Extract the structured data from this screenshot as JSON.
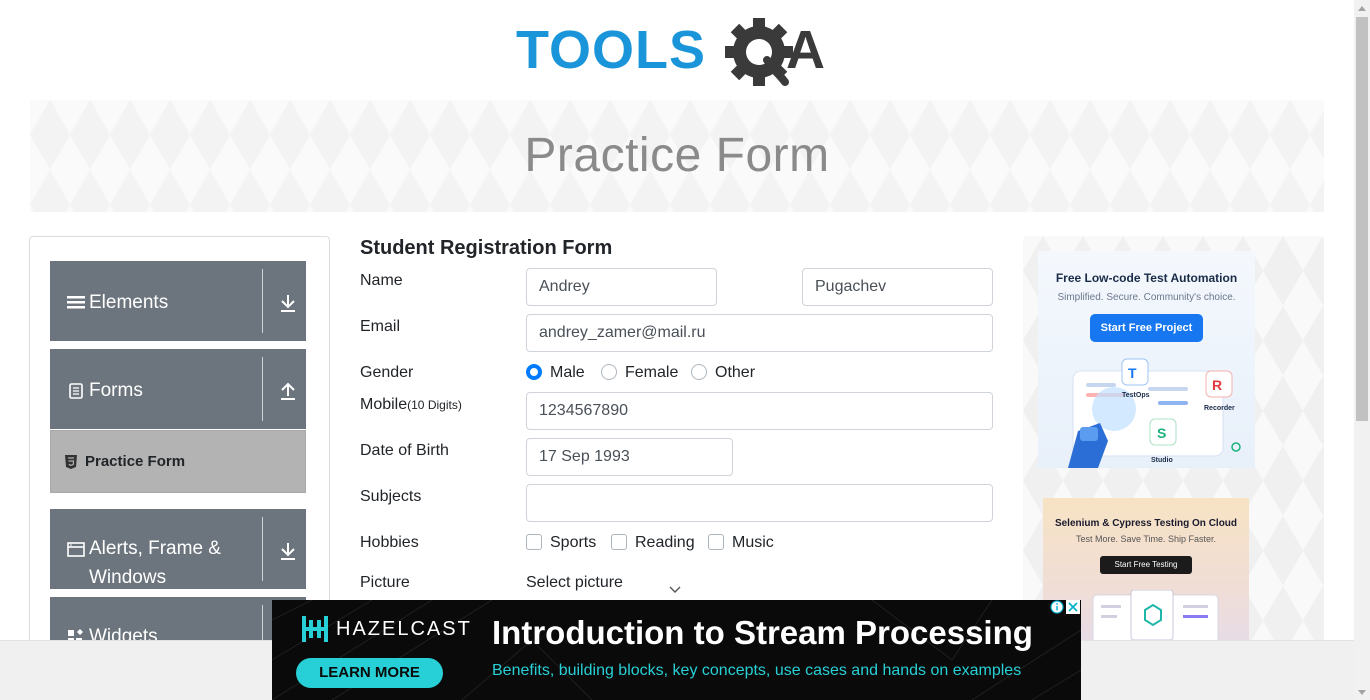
{
  "logo": {
    "text_left": "TOOLS",
    "text_right": "A"
  },
  "banner": {
    "title": "Practice Form"
  },
  "sidebar": {
    "groups": [
      {
        "label": "Elements",
        "icon": "hamburger-icon",
        "toggle": "download-icon"
      },
      {
        "label": "Forms",
        "icon": "document-icon",
        "toggle": "upload-icon"
      },
      {
        "label": "Alerts, Frame & Windows",
        "icon": "window-icon",
        "toggle": "download-icon"
      },
      {
        "label": "Widgets",
        "icon": "widgets-icon",
        "toggle": "download-icon"
      }
    ],
    "active_item": {
      "label": "Practice Form",
      "icon": "html5-icon"
    }
  },
  "form": {
    "title": "Student Registration Form",
    "labels": {
      "name": "Name",
      "email": "Email",
      "gender": "Gender",
      "mobile": "Mobile",
      "mobile_hint": "(10 Digits)",
      "dob": "Date of Birth",
      "subjects": "Subjects",
      "hobbies": "Hobbies",
      "picture": "Picture"
    },
    "first_name": "Andrey",
    "last_name": "Pugachev",
    "email": "andrey_zamer@mail.ru",
    "gender_options": [
      "Male",
      "Female",
      "Other"
    ],
    "gender_selected": "Male",
    "mobile": "1234567890",
    "dob": "17 Sep 1993",
    "subjects": "",
    "hobby_options": [
      "Sports",
      "Reading",
      "Music"
    ],
    "hobbies_checked": [],
    "picture_button": "Select picture"
  },
  "ads": {
    "right_top": {
      "title": "Free Low-code Test Automation",
      "subtitle": "Simplified. Secure. Community's choice.",
      "button": "Start Free Project",
      "labels": [
        "TestOps",
        "Recorder",
        "Studio"
      ]
    },
    "right_bottom": {
      "title": "Selenium & Cypress Testing On Cloud",
      "subtitle": "Test More. Save Time. Ship Faster.",
      "button": "Start Free Testing"
    },
    "bottom": {
      "brand": "HAZELCAST",
      "button": "LEARN MORE",
      "headline": "Introduction to Stream Processing",
      "subline": "Benefits, building blocks, key concepts, use cases and hands on examples"
    }
  },
  "colors": {
    "sidebar_group": "#6c757d",
    "sidebar_active": "#b3b3b3",
    "radio_selected": "#007bff",
    "logo_blue": "#1b95d9",
    "logo_dark": "#3a3a3a",
    "ad_accent": "#27d0d6"
  }
}
